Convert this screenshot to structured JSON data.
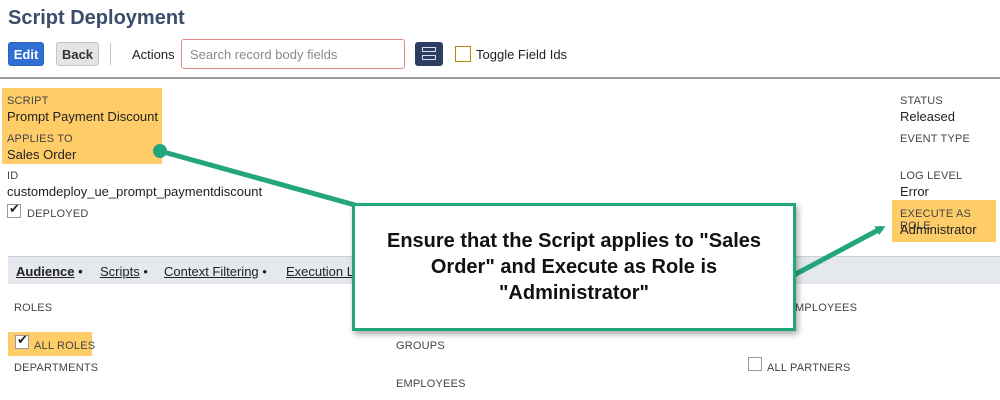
{
  "header": {
    "title": "Script Deployment",
    "edit_label": "Edit",
    "back_label": "Back",
    "actions_label": "Actions",
    "search_placeholder": "Search record body fields",
    "layout_icon": "layout-toggle-icon",
    "toggle_field_ids_label": "Toggle Field Ids"
  },
  "fields": {
    "script_label": "SCRIPT",
    "script_value": "Prompt Payment Discount",
    "applies_to_label": "APPLIES TO",
    "applies_to_value": "Sales Order",
    "id_label": "ID",
    "id_value": "customdeploy_ue_prompt_paymentdiscount",
    "deployed_label": "DEPLOYED",
    "status_label": "STATUS",
    "status_value": "Released",
    "event_type_label": "EVENT TYPE",
    "log_level_label": "LOG LEVEL",
    "log_level_value": "Error",
    "execute_as_role_label": "EXECUTE AS ROLE",
    "execute_as_role_value": "Administrator"
  },
  "tabs": [
    {
      "label": "Audience",
      "active": true
    },
    {
      "label": "Scripts"
    },
    {
      "label": "Context Filtering"
    },
    {
      "label": "Execution L"
    }
  ],
  "audience": {
    "roles_label": "ROLES",
    "all_roles_label": "ALL ROLES",
    "departments_label": "DEPARTMENTS",
    "groups_label": "GROUPS",
    "employees_label": "EMPLOYEES",
    "all_employees_label": "MPLOYEES",
    "all_partners_label": "ALL PARTNERS"
  },
  "callout": {
    "text": "Ensure that the Script applies to \"Sales Order\" and Execute as Role is \"Administrator\""
  },
  "colors": {
    "highlight": "#ffcd68",
    "callout_border": "#23a57d",
    "edit_button": "#2f6fd3",
    "title": "#3a4e6a"
  }
}
